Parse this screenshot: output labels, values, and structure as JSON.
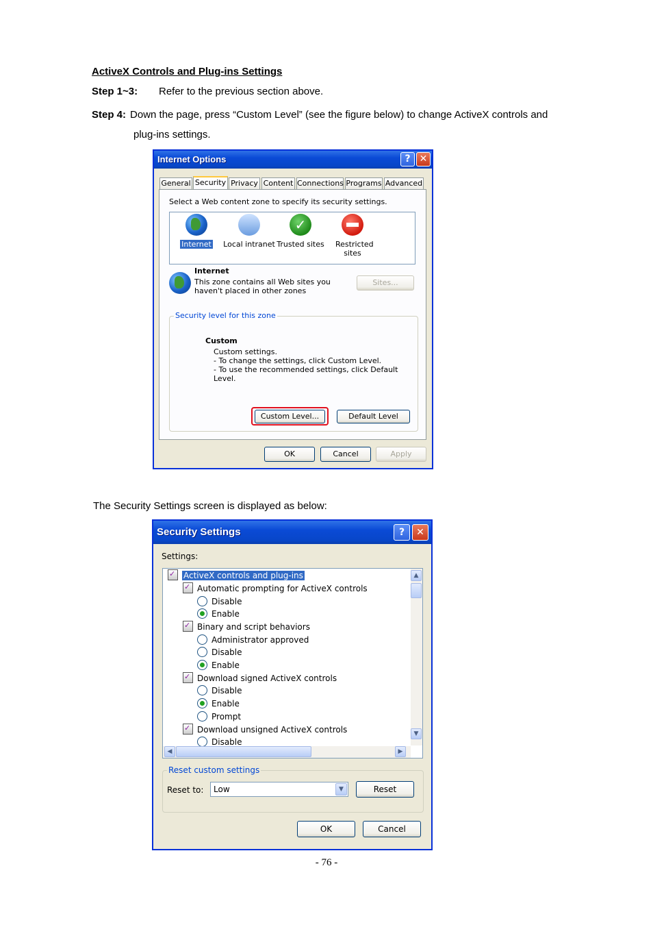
{
  "doc": {
    "heading": "ActiveX Controls and Plug-ins Settings",
    "step1_label": "Step 1~3:",
    "step1_text": "Refer to the previous section above.",
    "step4_label": "Step 4:",
    "step4_text_line1": "Down the page, press “Custom Level” (see the figure below) to change ActiveX controls and",
    "step4_text_line2": "plug-ins settings.",
    "caption": "The Security Settings screen is displayed as below:",
    "page_number": "- 76 -"
  },
  "internet_options": {
    "title": "Internet Options",
    "tabs": [
      "General",
      "Security",
      "Privacy",
      "Content",
      "Connections",
      "Programs",
      "Advanced"
    ],
    "active_tab": "Security",
    "zone_prompt": "Select a Web content zone to specify its security settings.",
    "zones": [
      {
        "name": "Internet",
        "icon": "globe-icon"
      },
      {
        "name": "Local intranet",
        "icon": "intranet-icon"
      },
      {
        "name": "Trusted sites",
        "icon": "trusted-check-icon"
      },
      {
        "name": "Restricted sites",
        "icon": "restricted-icon"
      }
    ],
    "zone_title": "Internet",
    "zone_desc_line1": "This zone contains all Web sites you",
    "zone_desc_line2": "haven't placed in other zones",
    "sites_button": "Sites...",
    "security_group_title": "Security level for this zone",
    "level_name": "Custom",
    "level_desc_1": "Custom settings.",
    "level_desc_2": "- To change the settings, click Custom Level.",
    "level_desc_3": "- To use the recommended settings, click Default Level.",
    "custom_level_button": "Custom Level...",
    "default_level_button": "Default Level",
    "ok_button": "OK",
    "cancel_button": "Cancel",
    "apply_button": "Apply",
    "highlight_color": "#e0101e"
  },
  "security_settings": {
    "title": "Security Settings",
    "settings_label": "Settings:",
    "items": [
      {
        "kind": "category",
        "label": "ActiveX controls and plug-ins",
        "selected": true
      },
      {
        "kind": "setting",
        "label": "Automatic prompting for ActiveX controls"
      },
      {
        "kind": "option",
        "label": "Disable",
        "checked": false
      },
      {
        "kind": "option",
        "label": "Enable",
        "checked": true
      },
      {
        "kind": "setting",
        "label": "Binary and script behaviors"
      },
      {
        "kind": "option",
        "label": "Administrator approved",
        "checked": false
      },
      {
        "kind": "option",
        "label": "Disable",
        "checked": false
      },
      {
        "kind": "option",
        "label": "Enable",
        "checked": true
      },
      {
        "kind": "setting",
        "label": "Download signed ActiveX controls"
      },
      {
        "kind": "option",
        "label": "Disable",
        "checked": false
      },
      {
        "kind": "option",
        "label": "Enable",
        "checked": true
      },
      {
        "kind": "option",
        "label": "Prompt",
        "checked": false
      },
      {
        "kind": "setting",
        "label": "Download unsigned ActiveX controls"
      },
      {
        "kind": "option",
        "label": "Disable",
        "checked": false
      }
    ],
    "reset_group_title": "Reset custom settings",
    "reset_to_label": "Reset to:",
    "reset_to_value": "Low",
    "reset_button": "Reset",
    "ok_button": "OK",
    "cancel_button": "Cancel"
  }
}
